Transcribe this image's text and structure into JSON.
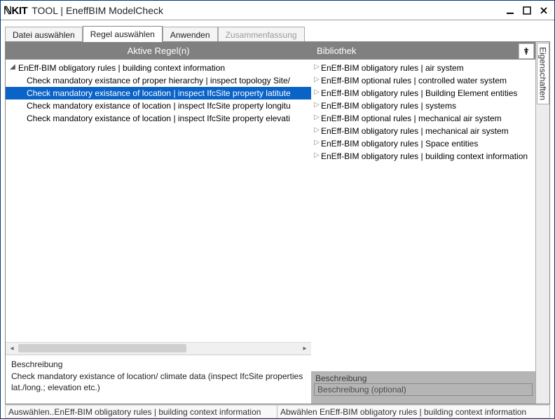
{
  "app": {
    "logo": "ℕKIT",
    "title": "TOOL | EneffBIM ModelCheck"
  },
  "tabs": {
    "items": [
      {
        "label": "Datei auswählen",
        "active": false,
        "disabled": false
      },
      {
        "label": "Regel auswählen",
        "active": true,
        "disabled": false
      },
      {
        "label": "Anwenden",
        "active": false,
        "disabled": false
      },
      {
        "label": "Zusammenfassung",
        "active": false,
        "disabled": true
      }
    ]
  },
  "panels": {
    "left_header": "Aktive Regel(n)",
    "right_header": "Bibliothek",
    "vtab_label": "Eigenschaften"
  },
  "active_rules": {
    "group": "EnEff-BIM obligatory rules | building context information",
    "items": [
      "Check mandatory existance of proper hierarchy | inspect topology Site/",
      "Check mandatory existance of location | inspect IfcSite property latitute",
      "Check mandatory existance of location | inspect IfcSite property longitu",
      "Check mandatory existance of location | inspect IfcSite property elevati"
    ],
    "selected_index": 1
  },
  "library": {
    "items": [
      "EnEff-BIM obligatory rules | air system",
      "EnEff-BIM optional rules | controlled water system",
      "EnEff-BIM obligatory rules | Building Element entities",
      "EnEff-BIM obligatory rules | systems",
      "EnEff-BIM optional rules | mechanical air system",
      "EnEff-BIM obligatory rules | mechanical air system",
      "EnEff-BIM obligatory rules | Space entities",
      "EnEff-BIM obligatory rules | building context information"
    ]
  },
  "description_left": {
    "title": "Beschreibung",
    "body": "Check mandatory existance of location/ climate data (inspect IfcSite properties lat./long.; elevation etc.)"
  },
  "description_right": {
    "title": "Beschreibung",
    "placeholder": "Beschreibung (optional)"
  },
  "statusbar": {
    "left": "Auswählen..EnEff-BIM obligatory rules | building context information",
    "right": "Abwählen EnEff-BIM obligatory rules | building context information"
  }
}
